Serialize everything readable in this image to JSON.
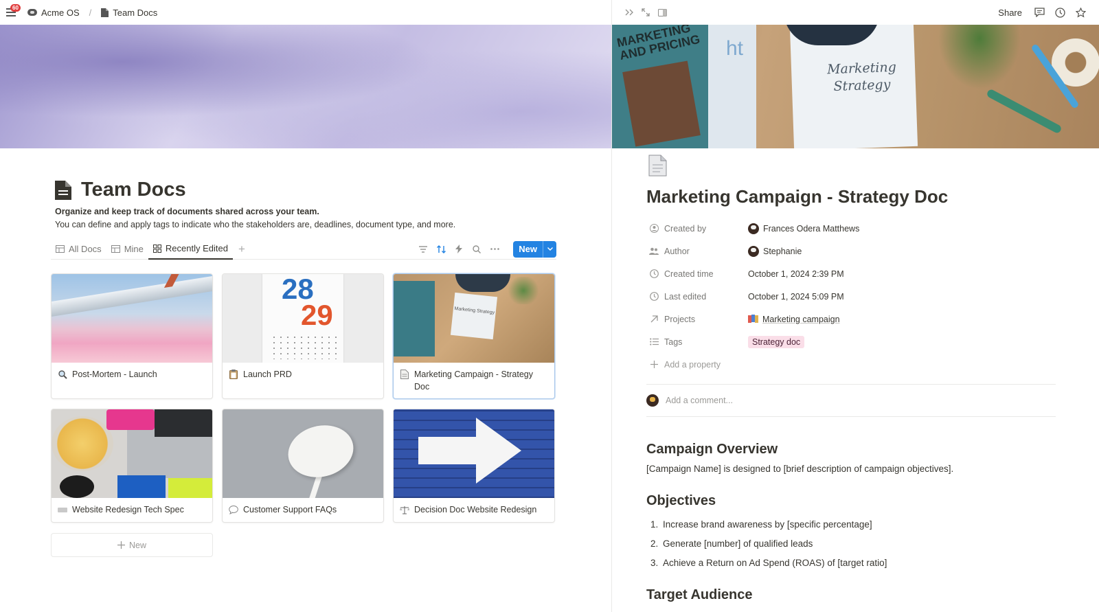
{
  "topbar": {
    "notification_count": "60",
    "workspace": "Acme OS",
    "separator": "/",
    "page": "Team Docs"
  },
  "left": {
    "title": "Team Docs",
    "description_bold": "Organize and keep track of documents shared across your team.",
    "description": "You can define and apply tags to indicate who the stakeholders are, deadlines, document type, and more.",
    "views": [
      {
        "label": "All Docs",
        "icon": "table-icon"
      },
      {
        "label": "Mine",
        "icon": "table-icon"
      },
      {
        "label": "Recently Edited",
        "icon": "gallery-icon",
        "active": true
      }
    ],
    "add_view": "+",
    "new_button": "New",
    "cards": [
      {
        "title": "Post-Mortem - Launch",
        "icon": "magnifier-icon"
      },
      {
        "title": "Launch PRD",
        "icon": "clipboard-icon"
      },
      {
        "title": "Marketing Campaign - Strategy Doc",
        "icon": "document-icon",
        "selected": true
      },
      {
        "title": "Website Redesign Tech Spec",
        "icon": "keyboard-icon"
      },
      {
        "title": "Customer Support FAQs",
        "icon": "speech-bubble-icon"
      },
      {
        "title": "Decision Doc Website Redesign",
        "icon": "scales-icon"
      }
    ],
    "thumb_text": {
      "calendar_top": "28",
      "calendar_bottom": "29",
      "marketing_paper": "Marketing Strategy"
    },
    "add_card": "New"
  },
  "right": {
    "topbar": {
      "share": "Share"
    },
    "cover": {
      "book_title": "MARKETING AND PRICING",
      "book2_text": "ht",
      "paper_text": "Marketing Strategy"
    },
    "title": "Marketing Campaign - Strategy Doc",
    "properties": [
      {
        "key": "Created by",
        "icon": "person-circle-icon",
        "value": "Frances Odera Matthews",
        "avatar": true
      },
      {
        "key": "Author",
        "icon": "people-icon",
        "value": "Stephanie",
        "avatar": true
      },
      {
        "key": "Created time",
        "icon": "clock-icon",
        "value": "October 1, 2024 2:39 PM"
      },
      {
        "key": "Last edited",
        "icon": "clock-icon",
        "value": "October 1, 2024 5:09 PM"
      },
      {
        "key": "Projects",
        "icon": "arrow-up-right-icon",
        "value": "Marketing campaign",
        "link": true
      },
      {
        "key": "Tags",
        "icon": "list-icon",
        "value": "Strategy doc",
        "tag": true
      }
    ],
    "add_property": "Add a property",
    "comment_placeholder": "Add a comment...",
    "sections": {
      "overview_heading": "Campaign Overview",
      "overview_text": "[Campaign Name] is designed to [brief description of campaign objectives].",
      "objectives_heading": "Objectives",
      "objectives": [
        {
          "num": "1.",
          "text": "Increase brand awareness by [specific percentage]"
        },
        {
          "num": "2.",
          "text": "Generate [number] of qualified leads"
        },
        {
          "num": "3.",
          "text": "Achieve a Return on Ad Spend (ROAS) of [target ratio]"
        }
      ],
      "audience_heading": "Target Audience"
    }
  }
}
